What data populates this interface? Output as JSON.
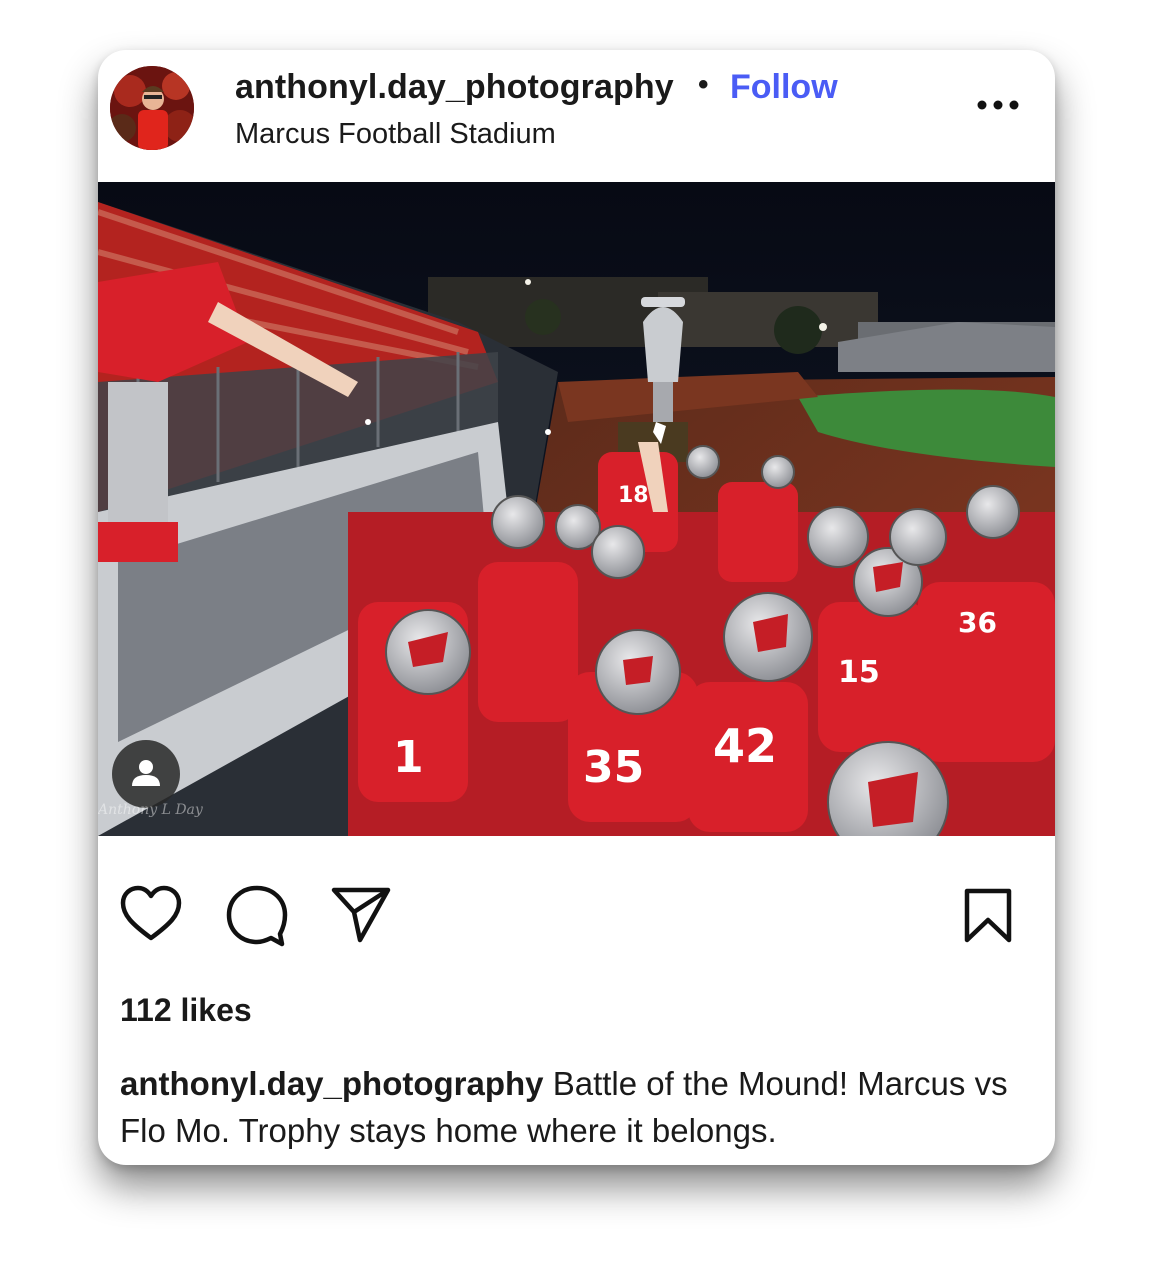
{
  "post": {
    "username": "anthonyl.day_photography",
    "separator": "•",
    "follow_label": "Follow",
    "location": "Marcus Football Stadium",
    "likes": "112 likes",
    "caption_user": "anthonyl.day_photography",
    "caption_text": " Battle of the Mound! Marcus vs Flo Mo. Trophy stays home where it belongs.",
    "photo_watermark": "Anthony L Day"
  },
  "icons": {
    "more": "more-options-icon",
    "like": "heart-icon",
    "comment": "comment-bubble-icon",
    "share": "paper-plane-icon",
    "save": "bookmark-icon",
    "tag": "user-tag-icon"
  },
  "colors": {
    "follow": "#4a5cf5",
    "text": "#1a1a1a",
    "team_red": "#d8202a"
  }
}
